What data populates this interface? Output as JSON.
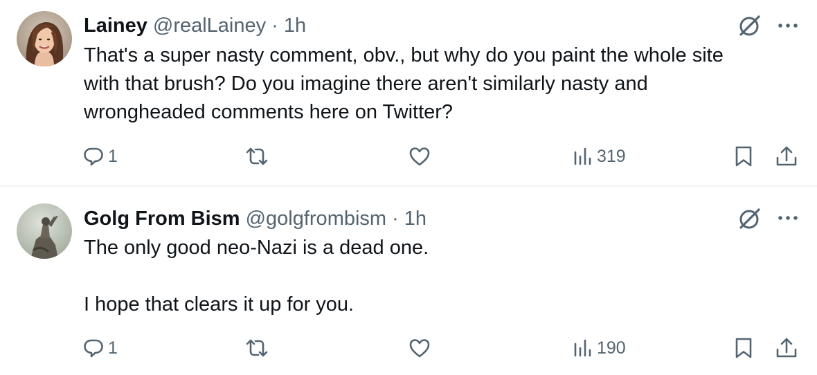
{
  "tweets": [
    {
      "author": {
        "name": "Lainey",
        "handle": "@realLainey",
        "time": "1h",
        "separator": "·",
        "avatar_icon": "woman-portrait-avatar"
      },
      "body_lines": [
        "That's a super nasty comment, obv., but why do you paint the whole site",
        "with that brush? Do you imagine there aren't similarly nasty and",
        "wrongheaded comments here on Twitter?"
      ],
      "stats": {
        "replies": "1",
        "retweets": "",
        "likes": "",
        "views": "319"
      }
    },
    {
      "author": {
        "name": "Golg From Bism",
        "handle": "@golgfrombism",
        "time": "1h",
        "separator": "·",
        "avatar_icon": "statue-avatar"
      },
      "body_lines": [
        "The only good neo-Nazi is a dead one.",
        "",
        "I hope that clears it up for you."
      ],
      "stats": {
        "replies": "1",
        "retweets": "",
        "likes": "",
        "views": "190"
      }
    }
  ],
  "icons": {
    "grok": "grok-icon",
    "more": "more-options-icon",
    "reply": "reply-icon",
    "retweet": "retweet-icon",
    "like": "heart-icon",
    "views": "views-chart-icon",
    "bookmark": "bookmark-icon",
    "share": "share-icon"
  },
  "colors": {
    "text": "#0f1419",
    "secondary": "#536471",
    "divider": "#eff3f4"
  }
}
